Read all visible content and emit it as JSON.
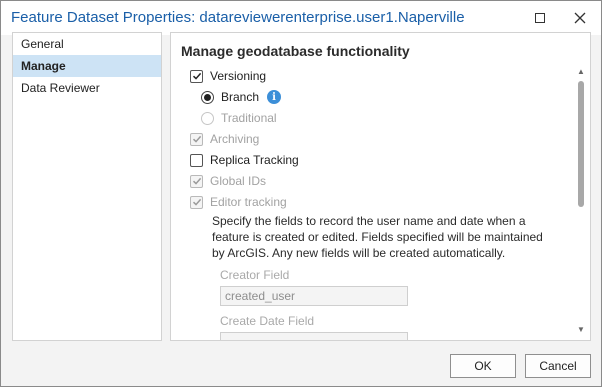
{
  "window": {
    "title": "Feature Dataset Properties: datareviewerenterprise.user1.Naperville"
  },
  "sidebar": {
    "items": [
      {
        "label": "General",
        "active": false
      },
      {
        "label": "Manage",
        "active": true
      },
      {
        "label": "Data Reviewer",
        "active": false
      }
    ]
  },
  "main": {
    "section_title": "Manage geodatabase functionality",
    "versioning": {
      "label": "Versioning",
      "checked": true,
      "enabled": true
    },
    "branch": {
      "label": "Branch",
      "selected": true,
      "enabled": true
    },
    "traditional": {
      "label": "Traditional",
      "selected": false,
      "enabled": false
    },
    "archiving": {
      "label": "Archiving",
      "checked": true,
      "enabled": false
    },
    "replica_tracking": {
      "label": "Replica Tracking",
      "checked": false,
      "enabled": true
    },
    "global_ids": {
      "label": "Global IDs",
      "checked": true,
      "enabled": false
    },
    "editor_tracking": {
      "label": "Editor tracking",
      "checked": true,
      "enabled": false
    },
    "editor_tracking_description": "Specify the fields to record the user name and date when a feature is created or edited. Fields specified will be maintained by ArcGIS. Any new fields will be created automatically.",
    "creator_field": {
      "label": "Creator Field",
      "value": "created_user"
    },
    "create_date_field": {
      "label": "Create Date Field",
      "value": ""
    }
  },
  "footer": {
    "ok_label": "OK",
    "cancel_label": "Cancel"
  },
  "icons": {
    "info": "info-icon",
    "maximize": "maximize-icon",
    "close": "close-icon"
  },
  "colors": {
    "title": "#1a5fa8",
    "active_nav": "#cde3f5",
    "info_icon": "#3c8fd8"
  }
}
